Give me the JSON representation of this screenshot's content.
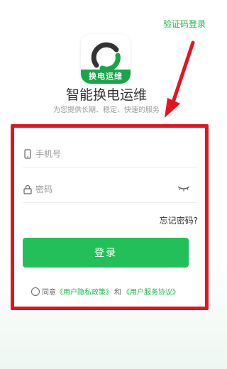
{
  "header": {
    "sms_login": "验证码登录"
  },
  "brand": {
    "logo_text": "换电运维",
    "title": "智能换电运维",
    "subtitle": "为您提供长期、稳定、快速的服务"
  },
  "form": {
    "phone_placeholder": "手机号",
    "password_placeholder": "密码",
    "forgot_label": "忘记密码?",
    "login_label": "登录",
    "agree_prefix": "同意",
    "privacy_link": "《用户隐私政策》",
    "and_text": "和",
    "service_link": "《用户服务协议》"
  },
  "colors": {
    "accent": "#23c05a",
    "link": "#21b84f",
    "annotation": "#e4141e"
  },
  "icons": {
    "phone": "phone-icon",
    "lock": "lock-icon",
    "eye_closed": "eye-closed-icon",
    "radio": "radio-unchecked-icon"
  }
}
